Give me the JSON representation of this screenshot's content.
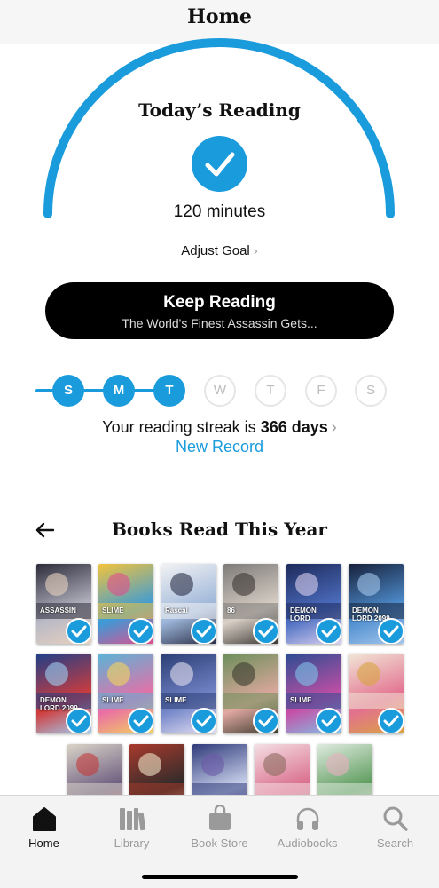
{
  "nav": {
    "title": "Home"
  },
  "today": {
    "title": "Today’s Reading",
    "minutes": "120 minutes",
    "adjust_goal": "Adjust Goal",
    "goal_progress": 1.0,
    "accent_color": "#1a9bdc"
  },
  "keep_reading": {
    "label": "Keep Reading",
    "book_title": "The World's Finest Assassin Gets..."
  },
  "streak": {
    "days": [
      {
        "label": "S",
        "done": true
      },
      {
        "label": "M",
        "done": true
      },
      {
        "label": "T",
        "done": true
      },
      {
        "label": "W",
        "done": false
      },
      {
        "label": "T",
        "done": false
      },
      {
        "label": "F",
        "done": false
      },
      {
        "label": "S",
        "done": false
      }
    ],
    "text_prefix": "Your reading streak is",
    "count": "366 days",
    "record": "New Record"
  },
  "books": {
    "title": "Books Read This Year",
    "items": [
      {
        "cover_text": "ASSASSIN",
        "colors": [
          "#2c2b3a",
          "#b9b9c6",
          "#e8d2c0"
        ],
        "finished": true
      },
      {
        "cover_text": "SLIME",
        "colors": [
          "#f2c33c",
          "#3c9bd7",
          "#e04f8e"
        ],
        "finished": true
      },
      {
        "cover_text": "Rascal",
        "colors": [
          "#f2f2f4",
          "#9cb5d8",
          "#2a2f47"
        ],
        "finished": true
      },
      {
        "cover_text": "86",
        "colors": [
          "#7d7a78",
          "#d9d0c6",
          "#3a3633"
        ],
        "finished": true
      },
      {
        "cover_text": "DEMON LORD",
        "colors": [
          "#1e2a5a",
          "#4d6fc2",
          "#d9d0f0"
        ],
        "finished": true
      },
      {
        "cover_text": "DEMON LORD 2099",
        "colors": [
          "#16203a",
          "#4f8fd0",
          "#a4c6ec"
        ],
        "finished": true
      },
      {
        "cover_text": "DEMON LORD 2099",
        "colors": [
          "#1f3f88",
          "#d23c3c",
          "#9ed1f4"
        ],
        "finished": true
      },
      {
        "cover_text": "SLIME",
        "colors": [
          "#5ab4d6",
          "#e96ea6",
          "#f4d45c"
        ],
        "finished": true
      },
      {
        "cover_text": "SLIME",
        "colors": [
          "#2c3e75",
          "#7486c9",
          "#e5e1f2"
        ],
        "finished": true
      },
      {
        "cover_text": "",
        "colors": [
          "#6c8f5a",
          "#e0a8a0",
          "#3b3a2e"
        ],
        "finished": true
      },
      {
        "cover_text": "SLIME",
        "colors": [
          "#2c4c92",
          "#c64fa5",
          "#7fc4e9"
        ],
        "finished": true
      },
      {
        "cover_text": "",
        "colors": [
          "#f1e6d6",
          "#e37090",
          "#d9a440"
        ],
        "finished": true
      },
      {
        "cover_text": "",
        "colors": [
          "#d9d4c8",
          "#6b5a7e",
          "#c23a3a"
        ],
        "finished": false
      },
      {
        "cover_text": "",
        "colors": [
          "#a83a2c",
          "#2b2b2b",
          "#f0e4c6"
        ],
        "finished": false
      },
      {
        "cover_text": "",
        "colors": [
          "#2f3a7a",
          "#cfd7ef",
          "#6b5aa8"
        ],
        "finished": false
      },
      {
        "cover_text": "",
        "colors": [
          "#f4dfe4",
          "#d96b8b",
          "#8c6b5e"
        ],
        "finished": false
      },
      {
        "cover_text": "",
        "colors": [
          "#dfeadf",
          "#5a9a5a",
          "#e7b0c0"
        ],
        "finished": false
      }
    ]
  },
  "tabs": [
    {
      "label": "Home",
      "icon": "home-icon",
      "active": true
    },
    {
      "label": "Library",
      "icon": "library-icon",
      "active": false
    },
    {
      "label": "Book Store",
      "icon": "book-store-icon",
      "active": false
    },
    {
      "label": "Audiobooks",
      "icon": "audiobooks-icon",
      "active": false
    },
    {
      "label": "Search",
      "icon": "search-icon",
      "active": false
    }
  ]
}
